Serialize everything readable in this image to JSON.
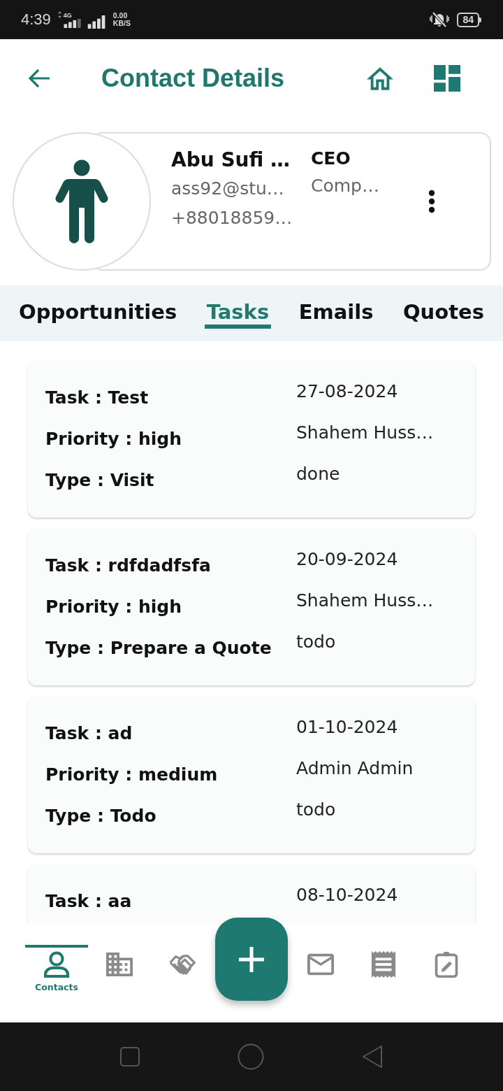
{
  "status_bar": {
    "time": "4:39",
    "network_type": "4G",
    "data_speed": "0.00",
    "speed_unit": "KB/S",
    "battery": "84"
  },
  "app_bar": {
    "title": "Contact Details"
  },
  "contact": {
    "name": "Abu Sufi …",
    "email": "ass92@stu…",
    "phone": "+88018859…",
    "job_title": "CEO",
    "company": "Comp…"
  },
  "tabs": [
    {
      "label": "Opportunities",
      "selected": false
    },
    {
      "label": "Tasks",
      "selected": true
    },
    {
      "label": "Emails",
      "selected": false
    },
    {
      "label": "Quotes",
      "selected": false
    }
  ],
  "tasks": [
    {
      "task": "Task : Test",
      "priority": "Priority : high",
      "type": "Type : Visit",
      "date": "27-08-2024",
      "assignee": "Shahem Huss…",
      "status": "done"
    },
    {
      "task": "Task : rdfdadfsfa",
      "priority": "Priority : high",
      "type": "Type : Prepare a Quote",
      "date": "20-09-2024",
      "assignee": "Shahem Huss…",
      "status": "todo"
    },
    {
      "task": "Task : ad",
      "priority": "Priority : medium",
      "type": "Type : Todo",
      "date": "01-10-2024",
      "assignee": "Admin Admin",
      "status": "todo"
    },
    {
      "task": "Task : aa",
      "date": "08-10-2024"
    }
  ],
  "bottom_nav": {
    "items": [
      {
        "kind": "person",
        "label": "Contacts",
        "selected": true
      },
      {
        "kind": "building",
        "selected": false
      },
      {
        "kind": "handshake",
        "selected": false
      },
      {
        "kind": "add"
      },
      {
        "kind": "envelope",
        "selected": false
      },
      {
        "kind": "receipt",
        "selected": false
      },
      {
        "kind": "clipboard",
        "selected": false
      }
    ]
  }
}
